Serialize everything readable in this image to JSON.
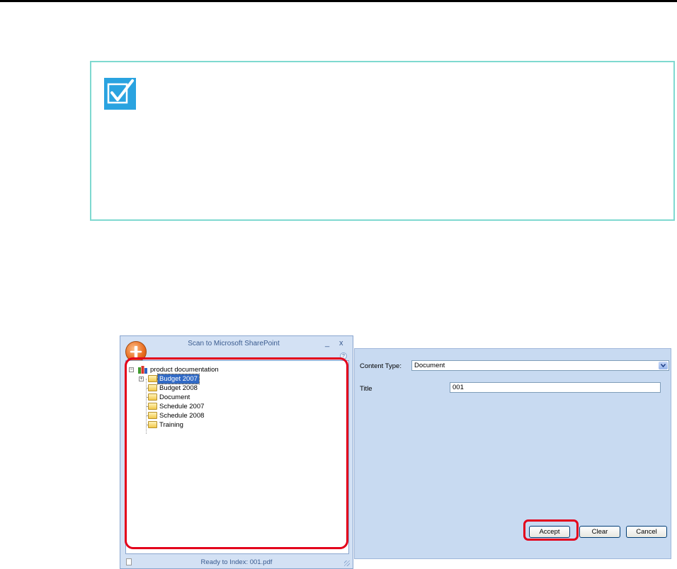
{
  "window": {
    "title": "Scan to Microsoft SharePoint",
    "minimize": "_",
    "close": "x",
    "help": "?"
  },
  "tree": {
    "root": "product documentation",
    "items": [
      "Budget 2007",
      "Budget 2008",
      "Document",
      "Schedule 2007",
      "Schedule 2008",
      "Training"
    ]
  },
  "status": {
    "text": "Ready to Index: 001.pdf"
  },
  "properties": {
    "content_type_label": "Content Type:",
    "content_type_value": "Document",
    "title_label": "Title",
    "title_value": "001"
  },
  "buttons": {
    "accept": "Accept",
    "clear": "Clear",
    "cancel": "Cancel"
  },
  "colors": {
    "highlight": "#e3001b",
    "hint_border": "#7fd9d0",
    "hint_icon": "#2aa3e0",
    "selection": "#316ac5"
  }
}
